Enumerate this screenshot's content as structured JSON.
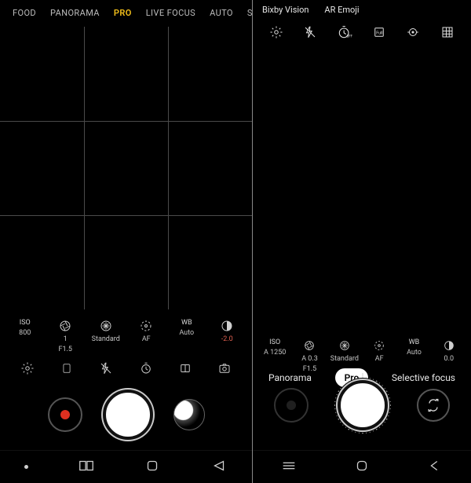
{
  "left": {
    "modes": [
      "FOOD",
      "PANORAMA",
      "PRO",
      "LIVE FOCUS",
      "AUTO",
      "SU"
    ],
    "selected_mode_index": 2,
    "pro_controls": [
      {
        "label": "ISO",
        "value": "800",
        "icon": null
      },
      {
        "label": "",
        "value": "1",
        "value2": "F1.5",
        "icon": "aperture"
      },
      {
        "label": "",
        "value": "Standard",
        "icon": "asterisk"
      },
      {
        "label": "",
        "value": "AF",
        "icon": "focus"
      },
      {
        "label": "WB",
        "value": "Auto",
        "icon": null
      },
      {
        "label": "",
        "value": "-2.0",
        "icon": "ev",
        "negative": true
      }
    ],
    "tools": [
      "settings",
      "phone",
      "flash-off",
      "timer",
      "grid",
      "capture"
    ]
  },
  "right": {
    "features": [
      "Bixby Vision",
      "AR Emoji"
    ],
    "top_tools": [
      "settings",
      "flash-off",
      "timer-off",
      "full",
      "metering",
      "grid"
    ],
    "pro_controls": [
      {
        "label": "ISO",
        "value": "A 1250",
        "icon": null
      },
      {
        "label": "",
        "value": "A 0.3",
        "value2": "F1.5",
        "icon": "aperture"
      },
      {
        "label": "",
        "value": "Standard",
        "icon": "asterisk"
      },
      {
        "label": "",
        "value": "AF",
        "icon": "focus"
      },
      {
        "label": "WB",
        "value": "Auto",
        "icon": null
      },
      {
        "label": "",
        "value": "0.0",
        "icon": "ev"
      }
    ],
    "mode_pills": [
      "Panorama",
      "Pro",
      "Selective focus"
    ],
    "selected_pill_index": 1
  },
  "nav_left": [
    "dot",
    "recents",
    "home",
    "back"
  ],
  "nav_right": [
    "recents-lines",
    "home-outline",
    "back-chevron"
  ]
}
